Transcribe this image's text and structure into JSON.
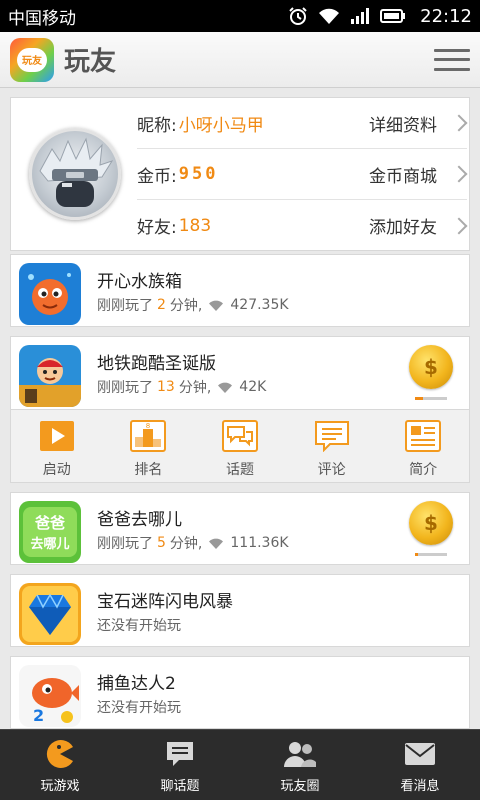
{
  "statusbar": {
    "carrier": "中国移动",
    "time": "22:12",
    "icons": [
      "alarm-icon",
      "wifi-icon",
      "signal-icon",
      "battery-icon"
    ]
  },
  "app": {
    "title": "玩友",
    "logo_text": "玩友"
  },
  "profile": {
    "nickname_label": "昵称:",
    "nickname": "小呀小马甲",
    "details_action": "详细资料",
    "coins_label": "金币:",
    "coins": "950",
    "coin_store_action": "金币商城",
    "friends_label": "好友:",
    "friends": "183",
    "add_friend_action": "添加好友"
  },
  "games": [
    {
      "name": "开心水族箱",
      "played_prefix": "刚刚玩了",
      "minutes": "2",
      "minutes_suffix": "分钟,",
      "size": "427.35K",
      "has_coin": false
    },
    {
      "name": "地铁跑酷圣诞版",
      "played_prefix": "刚刚玩了",
      "minutes": "13",
      "minutes_suffix": "分钟,",
      "size": "42K",
      "has_coin": true,
      "coin_progress": 0.25
    },
    {
      "name": "爸爸去哪儿",
      "played_prefix": "刚刚玩了",
      "minutes": "5",
      "minutes_suffix": "分钟,",
      "size": "111.36K",
      "has_coin": true,
      "coin_progress": 0.1
    },
    {
      "name": "宝石迷阵闪电风暴",
      "status": "还没有开始玩"
    },
    {
      "name": "捕鱼达人2",
      "status": "还没有开始玩"
    }
  ],
  "actions": [
    {
      "label": "启动",
      "icon": "play-icon"
    },
    {
      "label": "排名",
      "icon": "podium-icon"
    },
    {
      "label": "话题",
      "icon": "chat-bubbles-icon"
    },
    {
      "label": "评论",
      "icon": "comment-icon"
    },
    {
      "label": "简介",
      "icon": "info-card-icon"
    }
  ],
  "bottom_nav": [
    {
      "label": "玩游戏",
      "icon": "pacman-icon",
      "active": true
    },
    {
      "label": "聊话题",
      "icon": "chat-icon"
    },
    {
      "label": "玩友圈",
      "icon": "friends-icon"
    },
    {
      "label": "看消息",
      "icon": "mail-icon"
    }
  ],
  "colors": {
    "accent": "#f08a14",
    "navbar": "#2c2c2c",
    "background": "#e9e9e9"
  }
}
